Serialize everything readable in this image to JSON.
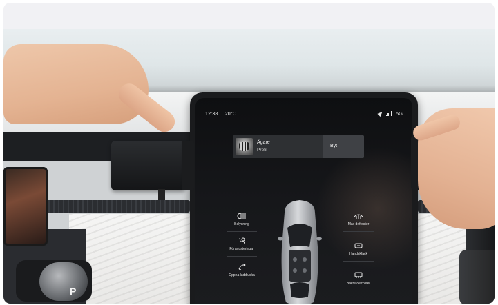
{
  "tablet": {
    "status": {
      "time": "12:38",
      "temp": "20°C",
      "network": "5G"
    },
    "profile": {
      "name": "Ägare",
      "subtitle": "Profil",
      "button": "Byt"
    },
    "controls_left": [
      {
        "label": "Belysning",
        "icon": "headlight-icon"
      },
      {
        "label": "Förarjusteringar",
        "icon": "seat-adjust-icon"
      },
      {
        "label": "Öppna laddlucka",
        "icon": "charge-port-icon"
      }
    ],
    "controls_right": [
      {
        "label": "Max defroster",
        "icon": "max-defrost-icon"
      },
      {
        "label": "Handskfack",
        "icon": "glovebox-icon"
      },
      {
        "label": "Bakre defroster",
        "icon": "rear-defrost-icon"
      }
    ]
  },
  "gear_selector": {
    "position": "P"
  },
  "colors": {
    "screen": "#101114",
    "panel": "#2e3033",
    "button": "#3f4145",
    "text": "#e8e8e8"
  }
}
